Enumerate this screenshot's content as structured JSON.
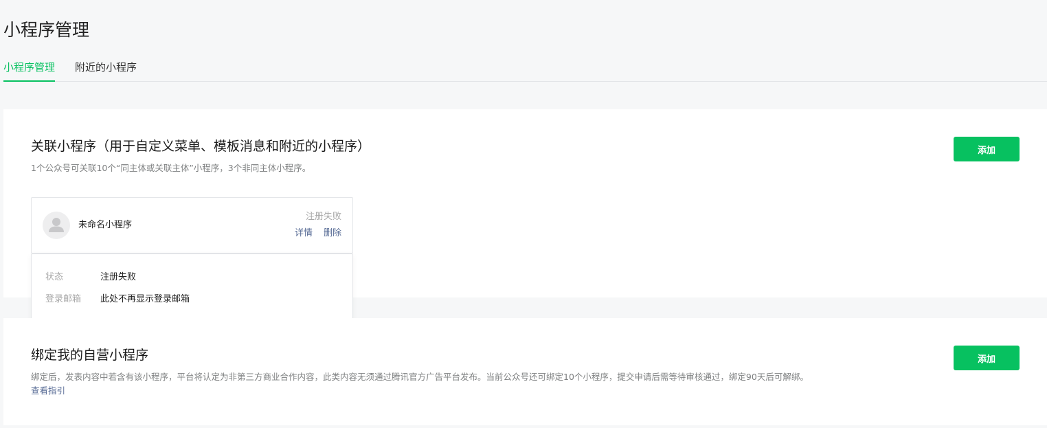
{
  "header": {
    "title": "小程序管理"
  },
  "tabs": [
    {
      "label": "小程序管理",
      "active": true
    },
    {
      "label": "附近的小程序",
      "active": false
    }
  ],
  "linked_section": {
    "title": "关联小程序（用于自定义菜单、模板消息和附近的小程序）",
    "description": "1个公众号可关联10个“同主体或关联主体”小程序，3个非同主体小程序。",
    "add_label": "添加",
    "item": {
      "avatar_icon": "default-user-avatar",
      "name": "未命名小程序",
      "status": "注册失败",
      "detail_label": "详情",
      "delete_label": "删除"
    },
    "detail_popover": {
      "rows": [
        {
          "label": "状态",
          "value": "注册失败"
        },
        {
          "label": "登录邮箱",
          "value": "此处不再显示登录邮箱"
        }
      ]
    }
  },
  "bind_section": {
    "title": "绑定我的自营小程序",
    "description": "绑定后，发表内容中若含有该小程序，平台将认定为非第三方商业合作内容，此类内容无须通过腾讯官方广告平台发布。当前公众号还可绑定10个小程序，提交申请后需等待审核通过，绑定90天后可解绑。",
    "guide_link": "查看指引",
    "add_label": "添加"
  },
  "colors": {
    "accent": "#07c160",
    "link": "#576b95",
    "muted": "#a8a8a8",
    "background": "#f6f7f8"
  }
}
